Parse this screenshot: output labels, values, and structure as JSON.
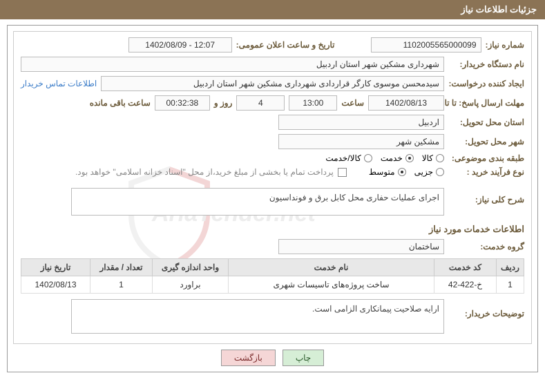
{
  "title_bar": "جزئیات اطلاعات نیاز",
  "fields": {
    "need_number_label": "شماره نیاز:",
    "need_number": "1102005565000099",
    "announce_datetime_label": "تاریخ و ساعت اعلان عمومی:",
    "announce_datetime": "1402/08/09 - 12:07",
    "buyer_org_label": "نام دستگاه خریدار:",
    "buyer_org": "شهرداری مشکین شهر استان اردبیل",
    "requester_label": "ایجاد کننده درخواست:",
    "requester": "سیدمحسن موسوی کارگر قراردادی شهرداری مشکین شهر استان اردبیل",
    "buyer_contact_link": "اطلاعات تماس خریدار",
    "deadline_label": "مهلت ارسال پاسخ: تا تاریخ:",
    "deadline_date": "1402/08/13",
    "time_label": "ساعت",
    "deadline_time": "13:00",
    "days_remaining": "4",
    "days_conj": "روز و",
    "time_remaining": "00:32:38",
    "time_remaining_suffix": "ساعت باقی مانده",
    "delivery_province_label": "استان محل تحویل:",
    "delivery_province": "اردبیل",
    "delivery_city_label": "شهر محل تحویل:",
    "delivery_city": "مشکین شهر",
    "subject_class_label": "طبقه بندی موضوعی:",
    "radio_goods": "کالا",
    "radio_service": "خدمت",
    "radio_goods_service": "کالا/خدمت",
    "purchase_type_label": "نوع فرآیند خرید :",
    "radio_minor": "جزیی",
    "radio_medium": "متوسط",
    "payment_note": "پرداخت تمام یا بخشی از مبلغ خرید،از محل \"اسناد خزانه اسلامی\" خواهد بود.",
    "general_desc_label": "شرح کلی نیاز:",
    "general_desc": "اجرای عملیات حفاری محل کابل برق و فونداسیون",
    "services_info_label": "اطلاعات خدمات مورد نیاز",
    "service_group_label": "گروه خدمت:",
    "service_group": "ساختمان",
    "buyer_notes_label": "توضیحات خریدار:",
    "buyer_notes": "ارایه صلاحیت پیمانکاری الزامی است."
  },
  "table": {
    "headers": {
      "row": "ردیف",
      "service_code": "کد خدمت",
      "service_name": "نام خدمت",
      "unit": "واحد اندازه گیری",
      "qty": "تعداد / مقدار",
      "need_date": "تاریخ نیاز"
    },
    "rows": [
      {
        "row": "1",
        "service_code": "خ-422-42",
        "service_name": "ساخت پروژه‌های تاسیسات شهری",
        "unit": "براورد",
        "qty": "1",
        "need_date": "1402/08/13"
      }
    ]
  },
  "buttons": {
    "print": "چاپ",
    "back": "بازگشت"
  },
  "watermark_text": "AriaTender.net"
}
